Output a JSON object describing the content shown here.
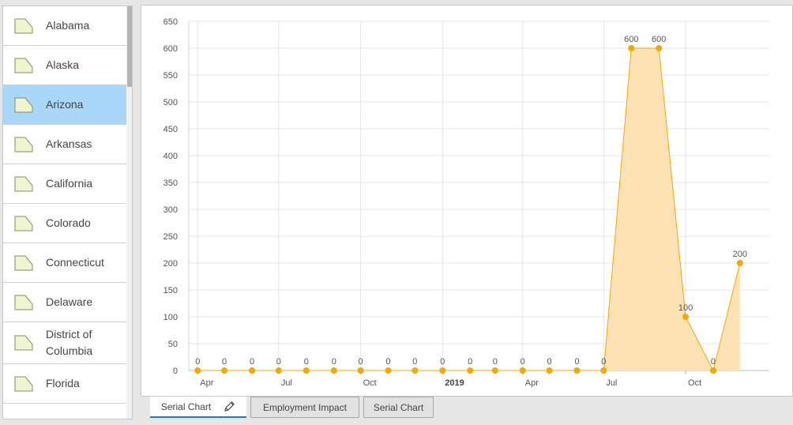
{
  "list": {
    "items": [
      {
        "label": "Alabama",
        "selected": false
      },
      {
        "label": "Alaska",
        "selected": false
      },
      {
        "label": "Arizona",
        "selected": true
      },
      {
        "label": "Arkansas",
        "selected": false
      },
      {
        "label": "California",
        "selected": false
      },
      {
        "label": "Colorado",
        "selected": false
      },
      {
        "label": "Connecticut",
        "selected": false
      },
      {
        "label": "Delaware",
        "selected": false
      },
      {
        "label": "District of Columbia",
        "selected": false
      },
      {
        "label": "Florida",
        "selected": false
      }
    ],
    "icon": "polygon-feature-icon",
    "colors": {
      "selected_bg": "#a9d7f8",
      "polygon_fill": "#eef5cf",
      "polygon_stroke": "#8a8a6a"
    }
  },
  "tabs": [
    {
      "label": "Serial Chart",
      "active": true,
      "icon": "pencil-icon"
    },
    {
      "label": "Employment Impact",
      "active": false
    },
    {
      "label": "Serial Chart",
      "active": false
    }
  ],
  "colors": {
    "tab_accent": "#1c7ac2"
  },
  "chart_data": {
    "type": "area",
    "title": "",
    "xlabel": "",
    "ylabel": "",
    "ylim": [
      0,
      650
    ],
    "yticks": [
      0,
      50,
      100,
      150,
      200,
      250,
      300,
      350,
      400,
      450,
      500,
      550,
      600,
      650
    ],
    "x_tick_labels": [
      {
        "label": "Apr",
        "date": "2018-04-01",
        "bold": false
      },
      {
        "label": "Jul",
        "date": "2018-07-01",
        "bold": false
      },
      {
        "label": "Oct",
        "date": "2018-10-01",
        "bold": false
      },
      {
        "label": "2019",
        "date": "2019-01-01",
        "bold": true
      },
      {
        "label": "Apr",
        "date": "2019-04-01",
        "bold": false
      },
      {
        "label": "Jul",
        "date": "2019-07-01",
        "bold": false
      },
      {
        "label": "Oct",
        "date": "2019-10-01",
        "bold": false
      }
    ],
    "grid": true,
    "series": [
      {
        "color": "#f5a800",
        "fill": "#fde3b4",
        "points": [
          {
            "x": "2018-04-01",
            "y": 0,
            "label": "0"
          },
          {
            "x": "2018-05-01",
            "y": 0,
            "label": "0"
          },
          {
            "x": "2018-06-01",
            "y": 0,
            "label": "0"
          },
          {
            "x": "2018-07-01",
            "y": 0,
            "label": "0"
          },
          {
            "x": "2018-08-01",
            "y": 0,
            "label": "0"
          },
          {
            "x": "2018-09-01",
            "y": 0,
            "label": "0"
          },
          {
            "x": "2018-10-01",
            "y": 0,
            "label": "0"
          },
          {
            "x": "2018-11-01",
            "y": 0,
            "label": "0"
          },
          {
            "x": "2018-12-01",
            "y": 0,
            "label": "0"
          },
          {
            "x": "2019-01-01",
            "y": 0,
            "label": "0"
          },
          {
            "x": "2019-02-01",
            "y": 0,
            "label": "0"
          },
          {
            "x": "2019-03-01",
            "y": 0,
            "label": "0"
          },
          {
            "x": "2019-04-01",
            "y": 0,
            "label": "0"
          },
          {
            "x": "2019-05-01",
            "y": 0,
            "label": "0"
          },
          {
            "x": "2019-06-01",
            "y": 0,
            "label": "0"
          },
          {
            "x": "2019-07-01",
            "y": 0,
            "label": "0"
          },
          {
            "x": "2019-08-01",
            "y": 600,
            "label": "600"
          },
          {
            "x": "2019-09-01",
            "y": 600,
            "label": "600"
          },
          {
            "x": "2019-10-01",
            "y": 100,
            "label": "100"
          },
          {
            "x": "2019-11-01",
            "y": 0,
            "label": "0"
          },
          {
            "x": "2019-12-01",
            "y": 200,
            "label": "200"
          }
        ]
      }
    ]
  }
}
